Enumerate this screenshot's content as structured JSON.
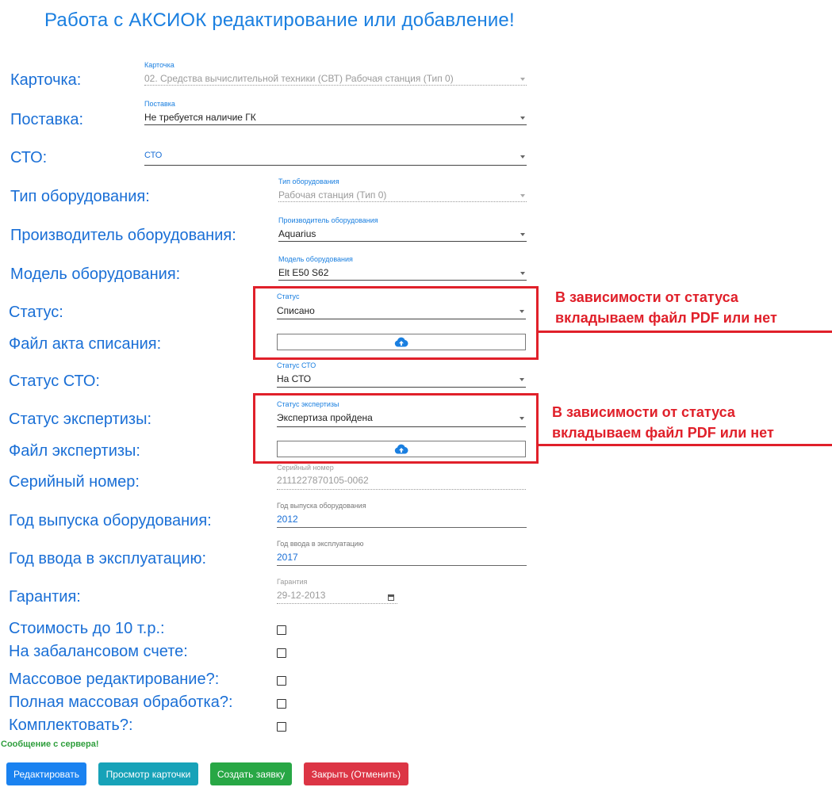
{
  "page": {
    "title": "Работа с АКСИОК редактирование или добавление!"
  },
  "rows": {
    "card": {
      "label": "Карточка:",
      "caption": "Карточка",
      "value": "02. Средства вычислительной техники (СВТ) Рабочая станция (Тип 0)"
    },
    "delivery": {
      "label": "Поставка:",
      "caption": "Поставка",
      "value": "Не требуется наличие ГК"
    },
    "sto": {
      "label": "СТО:",
      "value": "СТО"
    },
    "equipment_type": {
      "label": "Тип оборудования:",
      "caption": "Тип оборудования",
      "value": "Рабочая станция (Тип 0)"
    },
    "manufacturer": {
      "label": "Производитель оборудования:",
      "caption": "Производитель оборудования",
      "value": "Aquarius"
    },
    "model": {
      "label": "Модель оборудования:",
      "caption": "Модель оборудования",
      "value": "Elt E50 S62"
    },
    "status": {
      "label": "Статус:",
      "caption": "Статус",
      "value": "Списано"
    },
    "writeoff_file": {
      "label": "Файл акта списания:",
      "icon": "cloud-upload-icon"
    },
    "sto_status": {
      "label": "Статус СТО:",
      "caption": "Статус СТО",
      "value": "На СТО"
    },
    "expertise_status": {
      "label": "Статус экспертизы:",
      "caption": "Статус экспертизы",
      "value": "Экспертиза пройдена"
    },
    "expertise_file": {
      "label": "Файл экспертизы:",
      "icon": "cloud-upload-icon"
    },
    "serial": {
      "label": "Серийный номер:",
      "caption": "Серийный номер",
      "value": "2111227870105-0062"
    },
    "manufacture_year": {
      "label": "Год выпуска оборудования:",
      "caption": "Год выпуска оборудования",
      "value": "2012"
    },
    "commission_year": {
      "label": "Год ввода в эксплуатацию:",
      "caption": "Год ввода в эксплуатацию",
      "value": "2017"
    },
    "warranty": {
      "label": "Гарантия:",
      "caption": "Гарантия",
      "value": "29-12-2013"
    },
    "cost_under_10k": {
      "label": "Стоимость до 10 т.р.:",
      "checked": false
    },
    "on_balance": {
      "label": "На забалансовом счете:",
      "checked": false
    },
    "mass_edit": {
      "label": "Массовое редактирование?:",
      "checked": false
    },
    "full_mass_processing": {
      "label": "Полная массовая обработка?:",
      "checked": false
    },
    "bundle": {
      "label": "Комплектовать?:",
      "checked": false
    }
  },
  "annotations": {
    "status_note": "В зависимости от статуса\nвкладываем файл PDF или нет",
    "status_note_line1": "В зависимости от статуса",
    "status_note_line2": "вкладываем файл PDF или нет",
    "expertise_note_line1": "В зависимости от статуса",
    "expertise_note_line2": "вкладываем файл PDF или нет"
  },
  "server_message": "Сообщение с сервера!",
  "buttons": {
    "edit": "Редактировать",
    "view_card": "Просмотр карточки",
    "create_request": "Создать заявку",
    "close": "Закрыть (Отменить)"
  },
  "colors": {
    "label_blue": "#1a6fd6",
    "title_blue": "#1a7fe0",
    "annotation_red": "#e0202a",
    "btn_edit": "#1a82f0",
    "btn_view": "#17a2b8",
    "btn_create": "#28a745",
    "btn_close": "#dc3545",
    "server_msg_green": "#2e9e3c"
  }
}
